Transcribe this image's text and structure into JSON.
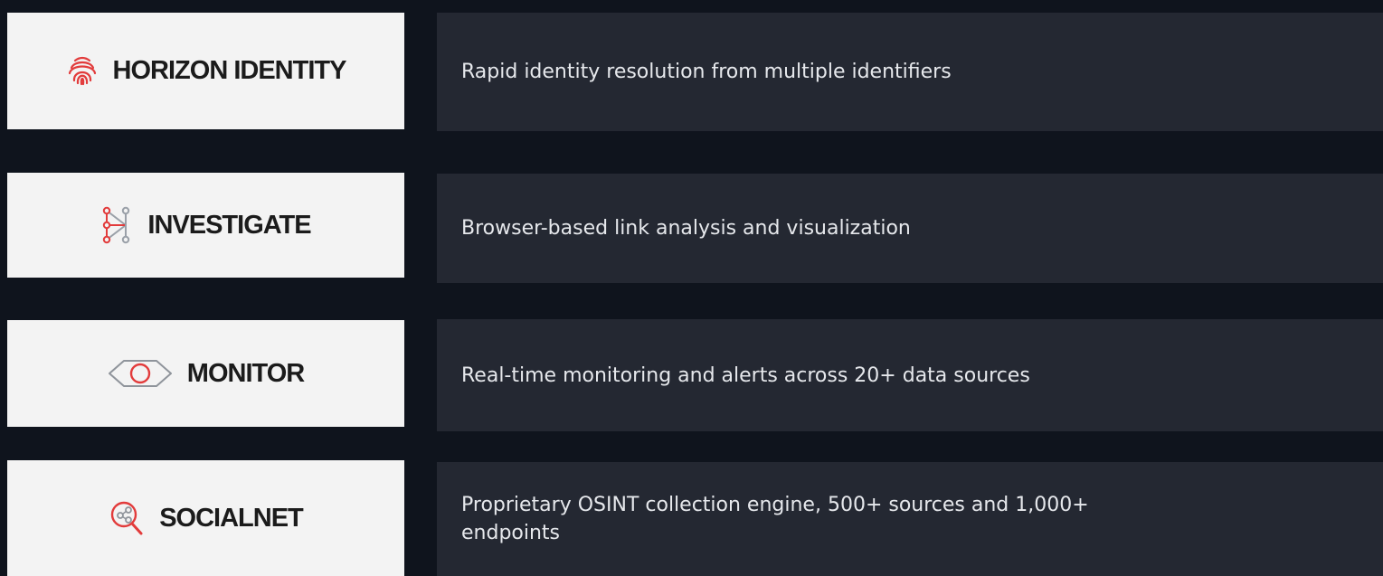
{
  "products": [
    {
      "name": "HORIZON IDENTITY",
      "icon": "fingerprint-icon",
      "description": "Rapid identity resolution from multiple identifiers"
    },
    {
      "name": "INVESTIGATE",
      "icon": "link-analysis-icon",
      "description": "Browser-based link analysis and visualization"
    },
    {
      "name": "MONITOR",
      "icon": "eye-icon",
      "description": "Real-time monitoring and alerts across 20+ data sources"
    },
    {
      "name": "SOCIALNET",
      "icon": "magnifier-network-icon",
      "description": "Proprietary OSINT collection engine, 500+ sources and 1,000+ endpoints"
    }
  ],
  "colors": {
    "background": "#0f141d",
    "logo_card": "#f3f3f3",
    "description_card": "#242832",
    "accent_red": "#e23b3b",
    "text_light": "#e6e8ec"
  }
}
